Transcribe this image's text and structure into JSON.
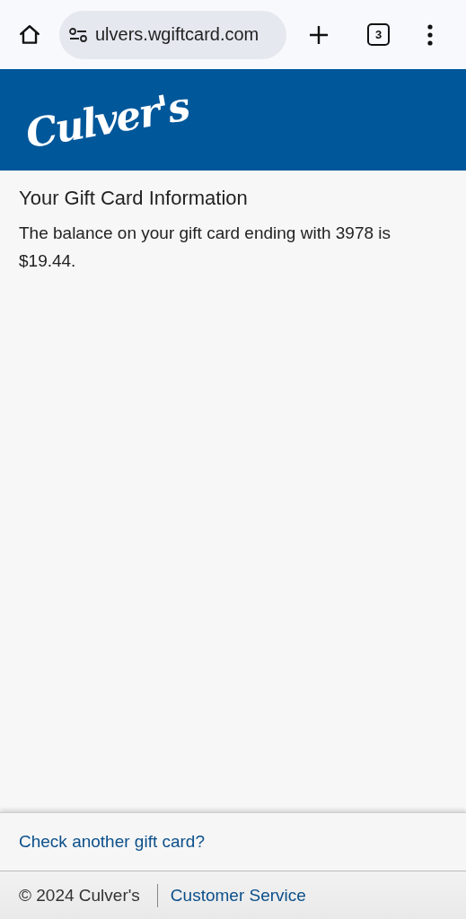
{
  "browser": {
    "url": "ulvers.wgiftcard.com",
    "tab_count": "3"
  },
  "header": {
    "logo": "Culver's"
  },
  "content": {
    "title": "Your Gift Card Information",
    "message": "The balance on your gift card ending with 3978 is $19.44."
  },
  "links": {
    "check_another": "Check another gift card?"
  },
  "footer": {
    "copyright": "© 2024 Culver's",
    "customer_service": "Customer Service"
  }
}
